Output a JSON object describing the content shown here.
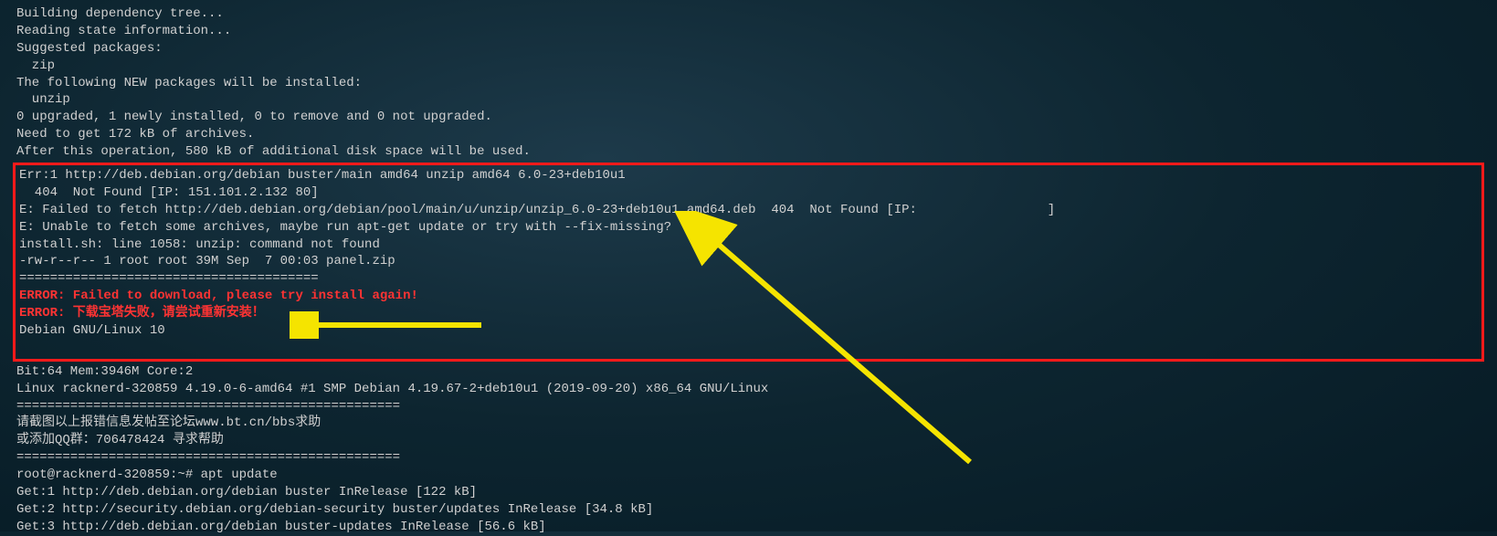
{
  "pre_lines": [
    "Building dependency tree...",
    "Reading state information...",
    "Suggested packages:",
    "  zip",
    "The following NEW packages will be installed:",
    "  unzip",
    "0 upgraded, 1 newly installed, 0 to remove and 0 not upgraded.",
    "Need to get 172 kB of archives.",
    "After this operation, 580 kB of additional disk space will be used."
  ],
  "box_lines": [
    "Err:1 http://deb.debian.org/debian buster/main amd64 unzip amd64 6.0-23+deb10u1",
    "  404  Not Found [IP: 151.101.2.132 80]",
    "E: Failed to fetch http://deb.debian.org/debian/pool/main/u/unzip/unzip_6.0-23+deb10u1_amd64.deb  404  Not Found [IP:                 ]",
    "E: Unable to fetch some archives, maybe run apt-get update or try with --fix-missing?",
    "install.sh: line 1058: unzip: command not found",
    "-rw-r--r-- 1 root root 39M Sep  7 00:03 panel.zip",
    "======================================="
  ],
  "box_error_lines": [
    "ERROR: Failed to download, please try install again!",
    "ERROR: 下载宝塔失败，请尝试重新安装！"
  ],
  "box_tail_lines": [
    "Debian GNU/Linux 10",
    ""
  ],
  "post_lines": [
    "Bit:64 Mem:3946M Core:2",
    "Linux racknerd-320859 4.19.0-6-amd64 #1 SMP Debian 4.19.67-2+deb10u1 (2019-09-20) x86_64 GNU/Linux",
    "==================================================",
    "请截图以上报错信息发帖至论坛www.bt.cn/bbs求助",
    "或添加QQ群：706478424 寻求帮助",
    "==================================================",
    "root@racknerd-320859:~# apt update",
    "Get:1 http://deb.debian.org/debian buster InRelease [122 kB]",
    "Get:2 http://security.debian.org/debian-security buster/updates InRelease [34.8 kB]",
    "Get:3 http://deb.debian.org/debian buster-updates InRelease [56.6 kB]"
  ]
}
